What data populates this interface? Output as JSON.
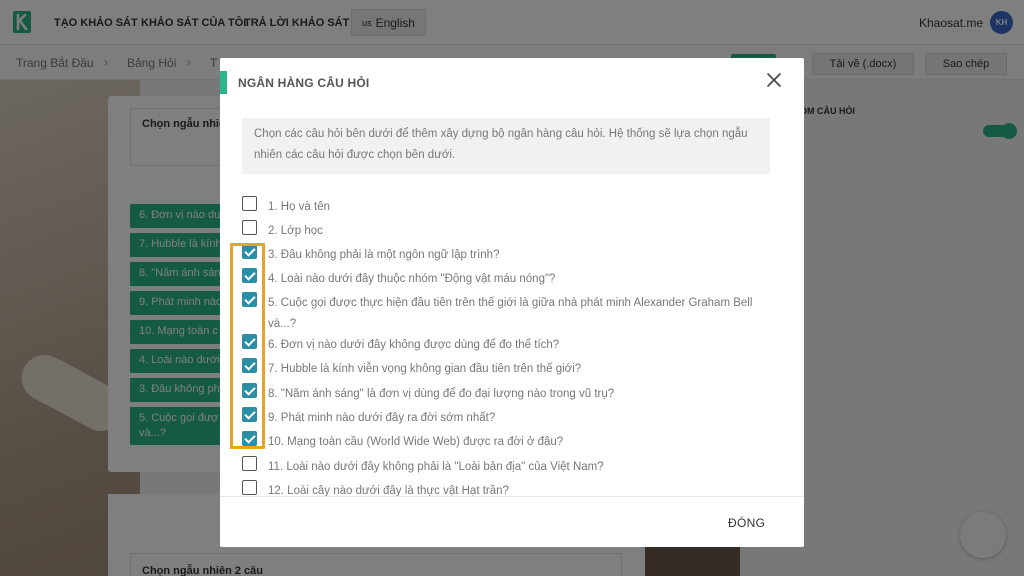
{
  "header": {
    "nav": [
      "TẠO KHẢO SÁT",
      "KHẢO SÁT CỦA TÔI",
      "TRẢ LỜI KHẢO SÁT"
    ],
    "language_flag": "us",
    "language": "English",
    "account": "Khaosat.me",
    "avatar_initials": "KH",
    "brand_color": "#2bb58a"
  },
  "breadcrumb": {
    "items": [
      "Trang Bắt Đầu",
      "Bảng Hỏi",
      "T"
    ],
    "separator": "›"
  },
  "toolbar": {
    "download_label": "Tải về (.docx)",
    "copy_label": "Sao chép"
  },
  "background": {
    "random_title": "Chọn ngẫu nhiê",
    "tags": [
      "6. Đơn vị nào dư",
      "7. Hubble là kính",
      "8. \"Năm ánh sán",
      "9. Phát minh nào",
      "10. Mạng toàn c",
      "4. Loài nào dưới",
      "3. Đâu không ph",
      "5. Cuộc gọi đượ",
      "và...?"
    ],
    "right_label": "OM CÂU HỎI",
    "bottom_title": "Chọn ngẫu nhiên 2 câu"
  },
  "modal": {
    "title": "NGÂN HÀNG CÂU HỎI",
    "description": "Chọn các câu hỏi bên dưới để thêm xây dựng bộ ngân hàng câu hỏi. Hệ thống sẽ lựa chọn ngẫu nhiên các câu hỏi được chọn bên dưới.",
    "checkbox_color": "#2b8fa3",
    "highlight_color": "#f0a020",
    "questions": [
      {
        "text": "1. Họ và tên",
        "checked": false
      },
      {
        "text": "2. Lớp học",
        "checked": false
      },
      {
        "text": "3. Đâu không phải là một ngôn ngữ lập trình?",
        "checked": true
      },
      {
        "text": "4. Loài nào dưới đây thuộc nhóm \"Động vật máu nóng\"?",
        "checked": true
      },
      {
        "text": "5. Cuộc gọi được thực hiện đầu tiên trên thế giới là giữa nhà phát minh Alexander Graham Bell và...?",
        "checked": true
      },
      {
        "text": "6. Đơn vị nào dưới đây không được dùng để đo thể tích?",
        "checked": true
      },
      {
        "text": "7. Hubble là kính viễn vọng không gian đầu tiên trên thế giới?",
        "checked": true
      },
      {
        "text": "8. \"Năm ánh sáng\" là đơn vị dùng để đo đại lượng nào trong vũ trụ?",
        "checked": true
      },
      {
        "text": "9. Phát minh nào dưới đây ra đời sớm nhất?",
        "checked": true
      },
      {
        "text": "10. Mạng toàn cầu (World Wide Web) được ra đời ở đâu?",
        "checked": true
      },
      {
        "text": "11. Loài nào dưới đây không phải là \"Loài bản địa\" của Việt Nam?",
        "checked": false
      },
      {
        "text": "12. Loài cây nào dưới đây là thực vật Hạt trần?",
        "checked": false
      }
    ],
    "close_label": "ĐÓNG"
  }
}
